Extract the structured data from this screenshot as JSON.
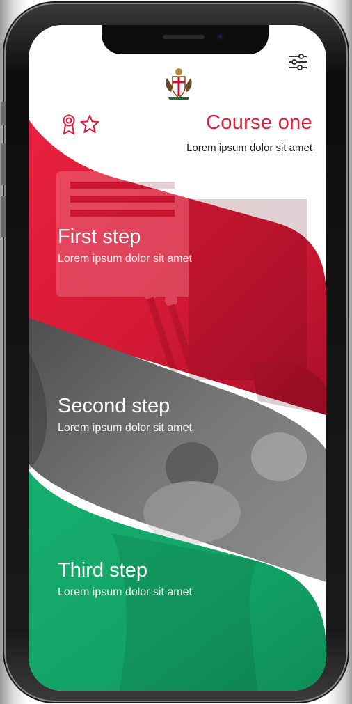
{
  "course": {
    "title": "Course one",
    "subtitle": "Lorem ipsum dolor sit amet"
  },
  "icons": {
    "crest": "coat-of-arms-crest",
    "filter": "sliders-filter-icon",
    "award": "award-ribbon-icon",
    "star": "star-outline-icon"
  },
  "steps": [
    {
      "title": "First step",
      "description": "Lorem ipsum dolor sit amet",
      "color": "#dc1f3a"
    },
    {
      "title": "Second step",
      "description": "Lorem ipsum dolor sit amet",
      "color": "#6e6e6e"
    },
    {
      "title": "Third step",
      "description": "Lorem ipsum dolor sit amet",
      "color": "#1daa6d"
    }
  ],
  "colors": {
    "accent": "#dd1f3c",
    "red_band": "#dc1f3a",
    "grey_band": "#6e6e6e",
    "green_band": "#1daa6d"
  }
}
